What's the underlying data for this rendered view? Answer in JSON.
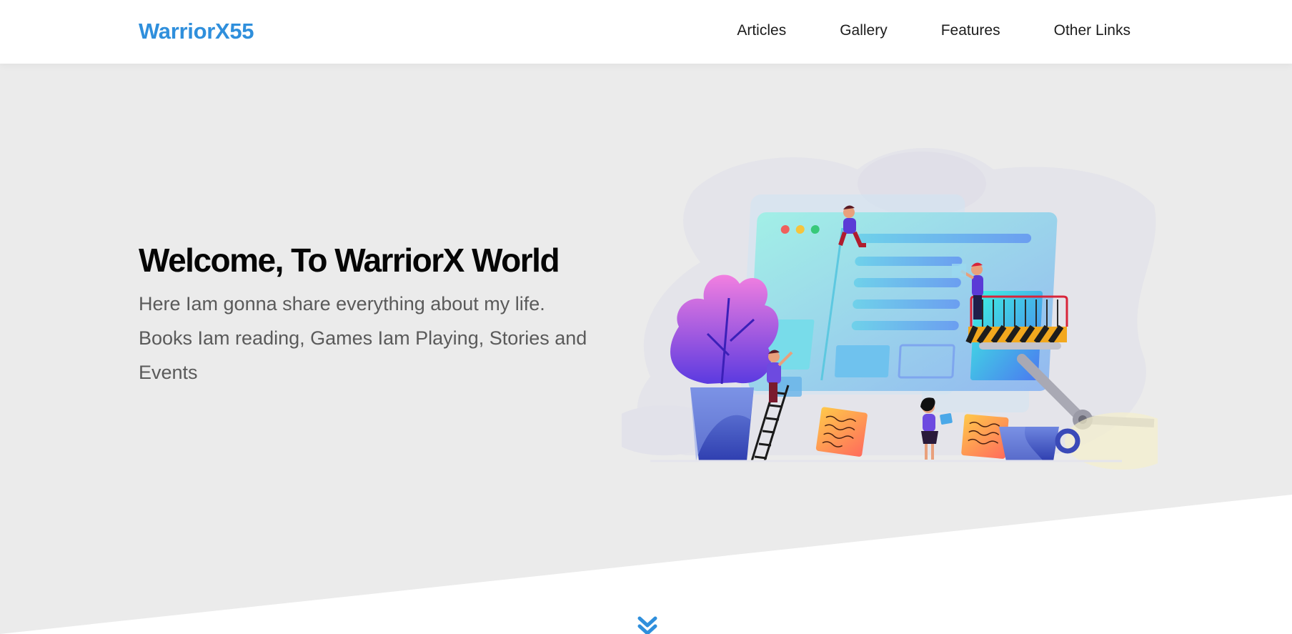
{
  "nav": {
    "brand": "WarriorX55",
    "links": [
      "Articles",
      "Gallery",
      "Features",
      "Other Links"
    ]
  },
  "hero": {
    "title": "Welcome, To WarriorX World",
    "text": "Here Iam gonna share everything about my life. Books Iam reading, Games Iam Playing, Stories and Events"
  },
  "icons": {
    "scroll": "double-chevron-down-icon"
  },
  "colors": {
    "brand": "#2f8fdc",
    "hero_bg": "#ebebeb",
    "page_bg": "#ffffff",
    "title": "#050505",
    "body_text": "#5a5a5a"
  }
}
